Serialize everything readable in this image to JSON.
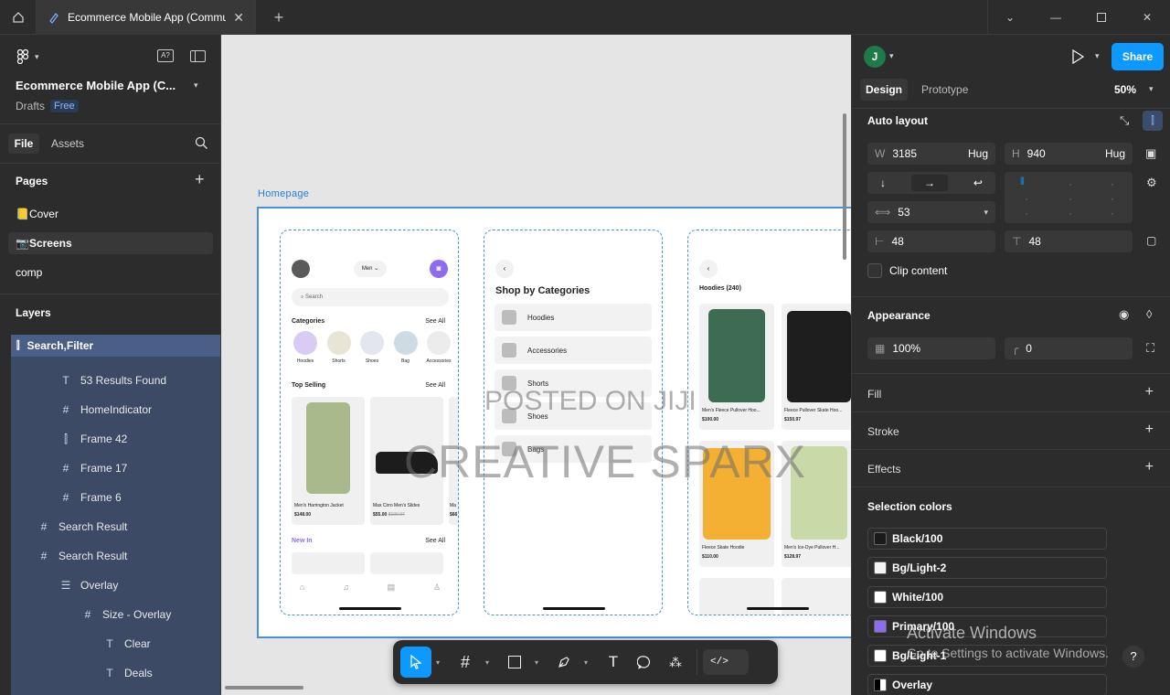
{
  "window": {
    "tab_title": "Ecommerce Mobile App (Commu"
  },
  "file": {
    "name": "Ecommerce Mobile App (C...",
    "location": "Drafts",
    "plan_badge": "Free",
    "avatar_initial": "A?"
  },
  "left_tabs": {
    "file": "File",
    "assets": "Assets"
  },
  "pages": {
    "title": "Pages",
    "items": [
      "📒Cover",
      "📷Screens",
      "comp"
    ]
  },
  "layers": {
    "title": "Layers",
    "selected": "Search,Filter",
    "items": [
      "53 Results Found",
      "HomeIndicator",
      "Frame 42",
      "Frame 17",
      "Frame 6",
      "Search Result",
      "Search Result",
      "Overlay",
      "Size - Overlay",
      "Clear",
      "Deals"
    ]
  },
  "canvas": {
    "frame_label": "Homepage",
    "watermark1": "POSTED ON JIJI",
    "watermark2": "CREATIVE SPARX",
    "screen1": {
      "dropdown": "Men",
      "search": "Search",
      "categories_title": "Categories",
      "see_all": "See All",
      "categories": [
        "Hoodies",
        "Shorts",
        "Shoes",
        "Bag",
        "Accessories"
      ],
      "top_selling": "Top Selling",
      "products": [
        {
          "name": "Men's Harrington Jacket",
          "price": "$148.00",
          "old": ""
        },
        {
          "name": "Max Cirro Men's Slides",
          "price": "$55.00",
          "old": "$100.97"
        },
        {
          "name": "Ma",
          "price": "$66",
          "old": ""
        }
      ],
      "new_in": "New In"
    },
    "screen2": {
      "title": "Shop by Categories",
      "items": [
        "Hoodies",
        "Accessories",
        "Shorts",
        "Shoes",
        "Bags"
      ]
    },
    "screen3": {
      "title": "Hoodies (240)",
      "products": [
        {
          "name": "Men's Fleece Pullover Hoo...",
          "price": "$100.00"
        },
        {
          "name": "Fleece Pullover Skate Hoo...",
          "price": "$150.97"
        },
        {
          "name": "Fleece Skate Hoodie",
          "price": "$110.00"
        },
        {
          "name": "Men's Ice-Dye Pullover H...",
          "price": "$128.97"
        }
      ]
    }
  },
  "right": {
    "user_initial": "J",
    "share": "Share",
    "tabs": {
      "design": "Design",
      "prototype": "Prototype"
    },
    "zoom": "50%",
    "auto_layout": {
      "title": "Auto layout",
      "w_label": "W",
      "w_value": "3185",
      "w_mode": "Hug",
      "h_label": "H",
      "h_value": "940",
      "h_mode": "Hug",
      "gap": "53",
      "pad_h": "48",
      "pad_v": "48",
      "clip": "Clip content"
    },
    "appearance": {
      "title": "Appearance",
      "opacity": "100%",
      "radius": "0"
    },
    "fill": "Fill",
    "stroke": "Stroke",
    "effects": "Effects",
    "selection_colors": {
      "title": "Selection colors",
      "items": [
        {
          "name": "Black/100",
          "color": "#1a1a1a"
        },
        {
          "name": "Bg/Light-2",
          "color": "#f4f4f4"
        },
        {
          "name": "White/100",
          "color": "#ffffff"
        },
        {
          "name": "Primary/100",
          "color": "#8e6cef"
        },
        {
          "name": "Bg/Light-1",
          "color": "#ffffff"
        },
        {
          "name": "Overlay",
          "color": "#000000"
        }
      ]
    }
  },
  "os_overlay": {
    "line1": "Activate Windows",
    "line2": "Go to Settings to activate Windows."
  },
  "help": "?",
  "colors": {
    "accent": "#0d99ff",
    "selection": "#3d4a66",
    "primary": "#8e6cef"
  }
}
